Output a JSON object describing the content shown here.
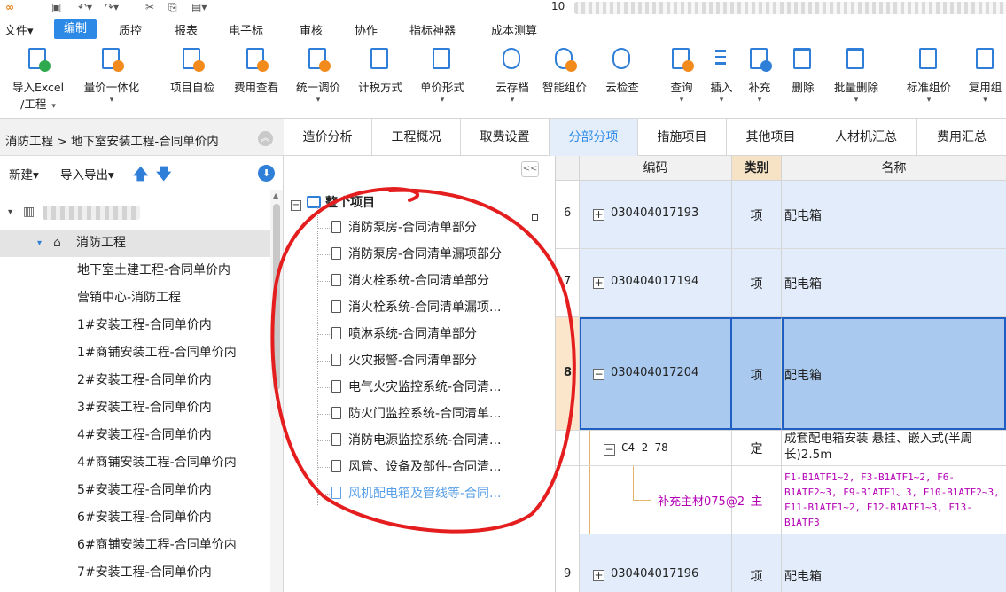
{
  "titlebar": {
    "doc_title": "10"
  },
  "menu": [
    "文件▾",
    "编制",
    "质控",
    "报表",
    "电子标",
    "审核",
    "协作",
    "指标神器",
    "成本测算"
  ],
  "ribbon": [
    {
      "l1": "导入Excel",
      "l2": "/工程",
      "dd": "▾"
    },
    {
      "l1": "量价一体化",
      "l2": "",
      "dd": "▾"
    },
    {
      "l1": "项目自检",
      "l2": "",
      "dd": ""
    },
    {
      "l1": "费用查看",
      "l2": "",
      "dd": ""
    },
    {
      "l1": "统一调价",
      "l2": "",
      "dd": "▾"
    },
    {
      "l1": "计税方式",
      "l2": "",
      "dd": ""
    },
    {
      "l1": "单价形式",
      "l2": "",
      "dd": "▾"
    },
    {
      "l1": "云存档",
      "l2": "",
      "dd": "▾"
    },
    {
      "l1": "智能组价",
      "l2": "",
      "dd": ""
    },
    {
      "l1": "云检查",
      "l2": "",
      "dd": ""
    },
    {
      "l1": "查询",
      "l2": "",
      "dd": "▾"
    },
    {
      "l1": "插入",
      "l2": "",
      "dd": "▾"
    },
    {
      "l1": "补充",
      "l2": "",
      "dd": "▾"
    },
    {
      "l1": "删除",
      "l2": "",
      "dd": ""
    },
    {
      "l1": "批量删除",
      "l2": "",
      "dd": "▾"
    },
    {
      "l1": "标准组价",
      "l2": "",
      "dd": "▾"
    },
    {
      "l1": "复用组",
      "l2": "",
      "dd": "▾"
    }
  ],
  "breadcrumb": "消防工程 > 地下室安装工程-合同单价内",
  "left_toolbar": {
    "new": "新建▾",
    "import_export": "导入导出▾"
  },
  "tree": {
    "root_name": "",
    "selected": "消防工程",
    "children": [
      "地下室土建工程-合同单价内",
      "营销中心-消防工程",
      "1#安装工程-合同单价内",
      "1#商铺安装工程-合同单价内",
      "2#安装工程-合同单价内",
      "3#安装工程-合同单价内",
      "4#安装工程-合同单价内",
      "4#商铺安装工程-合同单价内",
      "5#安装工程-合同单价内",
      "6#安装工程-合同单价内",
      "6#商铺安装工程-合同单价内",
      "7#安装工程-合同单价内"
    ]
  },
  "tabs": [
    "造价分析",
    "工程概况",
    "取费设置",
    "分部分项",
    "措施项目",
    "其他项目",
    "人材机汇总",
    "费用汇总"
  ],
  "parts": {
    "root": "整个项目",
    "items": [
      "消防泵房-合同清单部分",
      "消防泵房-合同清单漏项部分",
      "消火栓系统-合同清单部分",
      "消火栓系统-合同清单漏项...",
      "喷淋系统-合同清单部分",
      "火灾报警-合同清单部分",
      "电气火灾监控系统-合同清...",
      "防火门监控系统-合同清单...",
      "消防电源监控系统-合同清...",
      "风管、设备及部件-合同清...",
      "风机配电箱及管线等-合同..."
    ]
  },
  "grid": {
    "headers": [
      "编码",
      "类别",
      "名称"
    ],
    "rows": [
      {
        "num": "6",
        "code": "030404017193",
        "cat": "项",
        "name": "配电箱"
      },
      {
        "num": "7",
        "code": "030404017194",
        "cat": "项",
        "name": "配电箱"
      },
      {
        "num": "8",
        "code": "030404017204",
        "cat": "项",
        "name": "配电箱"
      },
      {
        "num": "",
        "code": "C4-2-78",
        "cat": "定",
        "name": "成套配电箱安装 悬挂、嵌入式(半周长)2.5m"
      },
      {
        "num": "",
        "code": "补充主材075@2",
        "cat": "主",
        "name": "F1-B1ATF1~2, F3-B1ATF1~2, F6-B1ATF2~3, F9-B1ATF1、3, F10-B1ATF2~3, F11-B1ATF1~2, F12-B1ATF1~3, F13-B1ATF3"
      },
      {
        "num": "9",
        "code": "030404017196",
        "cat": "项",
        "name": "配电箱"
      }
    ]
  },
  "colors": {
    "accent": "#2c8ae6",
    "annotation": "#e41e1e",
    "selected_row": "#a9c9ef",
    "material_text": "#b400b4"
  }
}
